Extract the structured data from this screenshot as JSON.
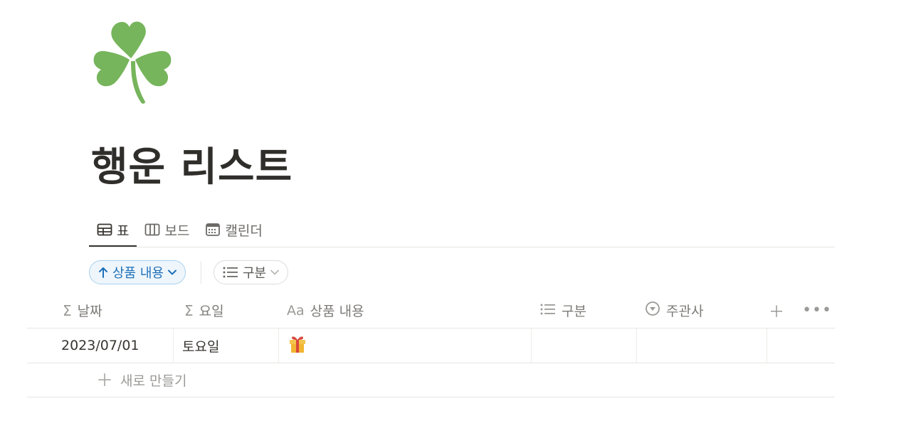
{
  "page": {
    "icon": "four-leaf-clover-icon",
    "title": "행운 리스트"
  },
  "views": [
    {
      "label": "표",
      "icon": "table-icon",
      "active": true
    },
    {
      "label": "보드",
      "icon": "board-icon",
      "active": false
    },
    {
      "label": "캘린더",
      "icon": "calendar-icon",
      "active": false
    }
  ],
  "chips": {
    "sort": {
      "label": "상품 내용",
      "icon": "arrow-up-icon",
      "caret": "chevron-down-icon"
    },
    "filter": {
      "label": "구분",
      "icon": "list-icon",
      "caret": "chevron-down-icon"
    }
  },
  "table": {
    "columns": [
      {
        "label": "날짜",
        "icon": "sigma-icon",
        "icon_glyph": "Σ"
      },
      {
        "label": "요일",
        "icon": "sigma-icon",
        "icon_glyph": "Σ"
      },
      {
        "label": "상품 내용",
        "icon": "text-icon",
        "icon_glyph": "Aa"
      },
      {
        "label": "구분",
        "icon": "list-icon",
        "icon_glyph": "☰"
      },
      {
        "label": "주관사",
        "icon": "select-icon",
        "icon_glyph": "▾"
      }
    ],
    "add_column_icon": "plus-icon",
    "more_icon": "more-icon",
    "rows": [
      {
        "date": "2023/07/01",
        "weekday": "토요일",
        "content_icon": "gift-icon",
        "category": "",
        "host": ""
      }
    ],
    "new_row_label": "새로 만들기"
  },
  "colors": {
    "accent": "#1d6fb8",
    "clover": "#76b55c",
    "text": "#37352f"
  }
}
